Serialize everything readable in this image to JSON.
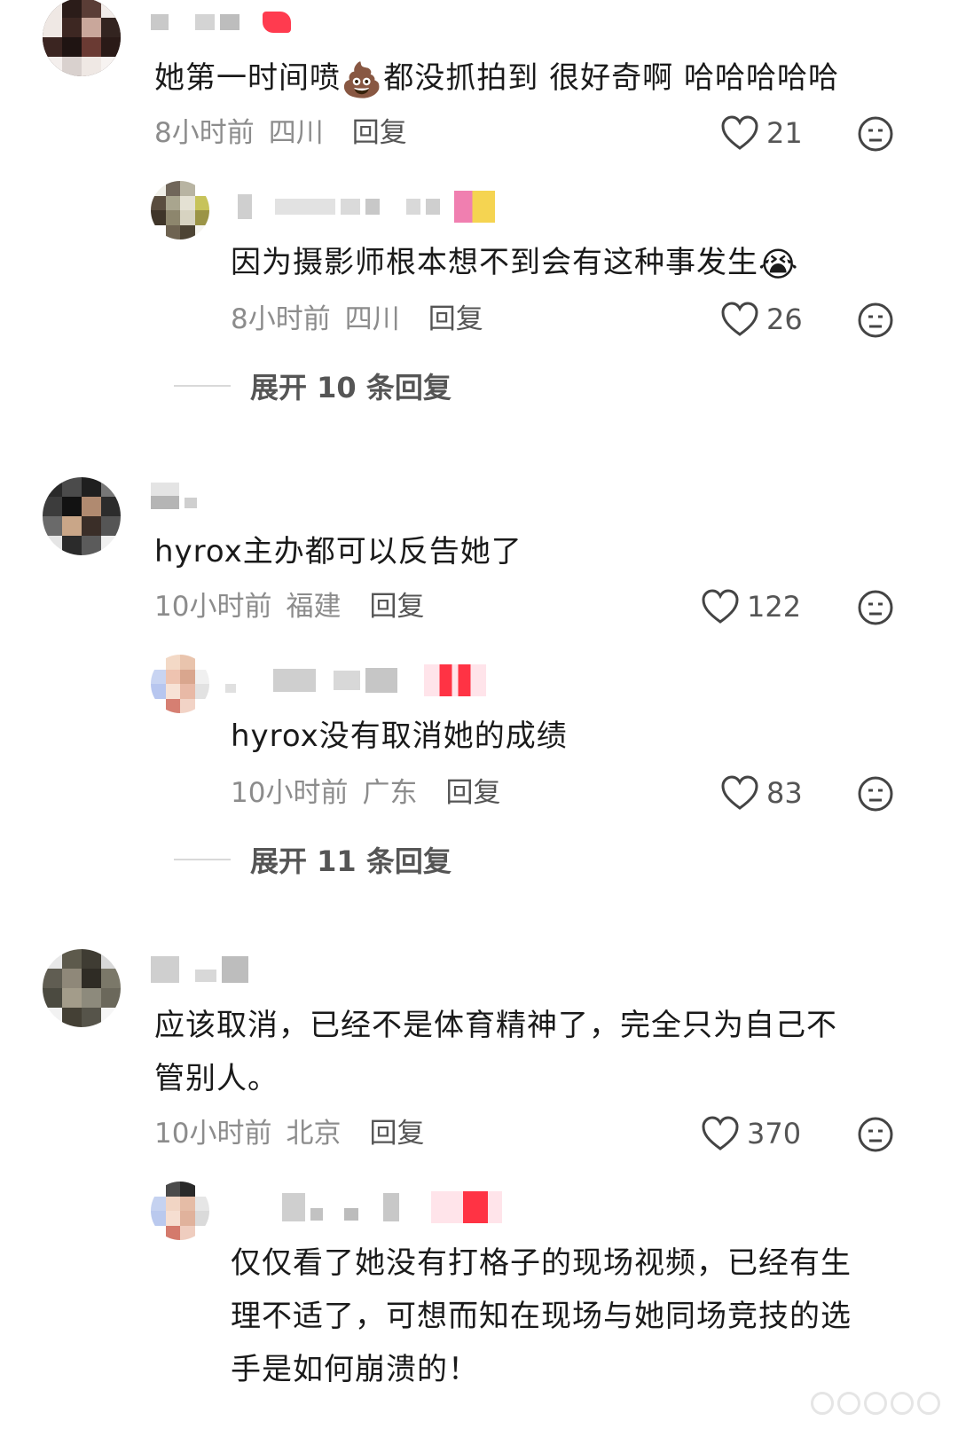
{
  "comments": [
    {
      "text_1": "她第一时间喷",
      "emoji": "💩",
      "text_2": "都没抓拍到 很好奇啊 哈哈哈哈哈",
      "time": "8小时前",
      "region": "四川",
      "reply_label": "回复",
      "likes": "21",
      "reply": {
        "text_1": "因为摄影师根本想不到会有这种事发生",
        "emoji": "😭",
        "time": "8小时前",
        "region": "四川",
        "reply_label": "回复",
        "likes": "26"
      },
      "expand_label": "展开 10 条回复"
    },
    {
      "text_1": "hyrox主办都可以反告她了",
      "time": "10小时前",
      "region": "福建",
      "reply_label": "回复",
      "likes": "122",
      "reply": {
        "text_1": "hyrox没有取消她的成绩",
        "time": "10小时前",
        "region": "广东",
        "reply_label": "回复",
        "likes": "83"
      },
      "expand_label": "展开 11 条回复"
    },
    {
      "text_1": "应该取消，已经不是体育精神了，完全只为自己不",
      "text_2": "管别人。",
      "time": "10小时前",
      "region": "北京",
      "reply_label": "回复",
      "likes": "370",
      "reply": {
        "line_1": "仅仅看了她没有打格子的现场视频，已经有生",
        "line_2": "理不适了，可想而知在现场与她同场竞技的选",
        "line_3": "手是如何崩溃的！"
      }
    }
  ],
  "icons": {
    "like": "heart-outline-icon",
    "dislike": "neutral-face-icon"
  },
  "colors": {
    "text": "#1a1a1a",
    "meta": "#8c8c8c",
    "secondary": "#555555",
    "divider": "#d9d9d9"
  }
}
